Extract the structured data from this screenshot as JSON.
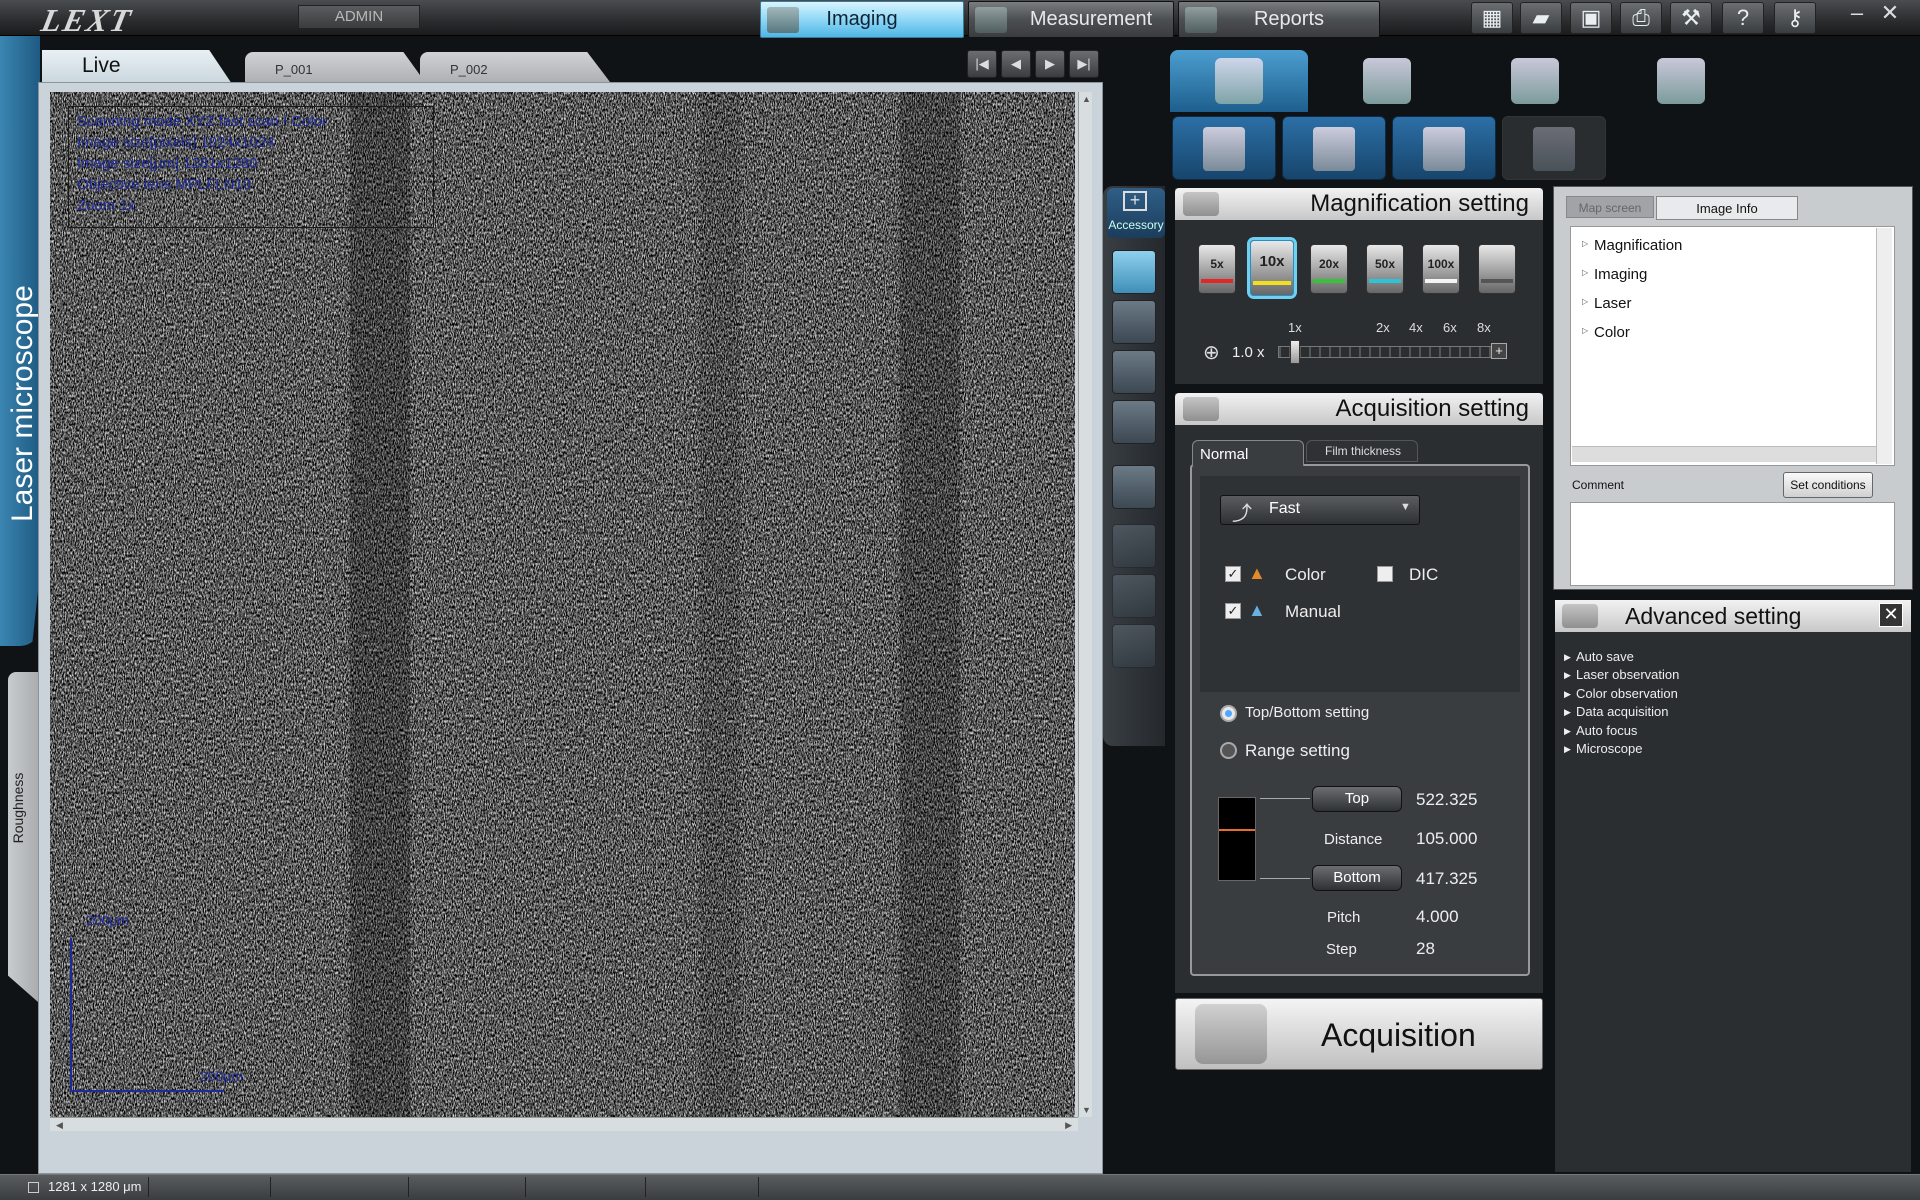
{
  "app": {
    "logo": "LEXT",
    "user": "ADMIN",
    "side_label": "Laser microscope",
    "roughness_tab": "Roughness"
  },
  "modes": [
    {
      "label": "Imaging",
      "active": true
    },
    {
      "label": "Measurement",
      "active": false
    },
    {
      "label": "Reports",
      "active": false
    }
  ],
  "toolbar_icons": [
    "calculator-icon",
    "open-folder-icon",
    "save-icon",
    "print-icon",
    "wrench-icon",
    "help-icon",
    "key-icon"
  ],
  "window_controls": {
    "minimize": "–",
    "close": "✕"
  },
  "image_tabs": [
    {
      "label": "Live",
      "active": true
    },
    {
      "label": "P_001",
      "active": false
    },
    {
      "label": "P_002",
      "active": false
    }
  ],
  "image_overlay": [
    "Scanning mode XYZ fast scan / Color",
    "Image size[pixels]  1024x1024",
    "Image size[μm]  1281x1280",
    "Objective lens MPLFLN10",
    "Zoom  1x"
  ],
  "scale_bar": {
    "vertical": "200μm",
    "horizontal": "200μm"
  },
  "tools": {
    "accessory_label": "Accessory"
  },
  "magnification": {
    "title": "Magnification setting",
    "objectives": [
      {
        "label": "5x",
        "band": "#e02828",
        "selected": false
      },
      {
        "label": "10x",
        "band": "#f2e01e",
        "selected": true
      },
      {
        "label": "20x",
        "band": "#3ac03a",
        "selected": false
      },
      {
        "label": "50x",
        "band": "#2cc4d8",
        "selected": false
      },
      {
        "label": "100x",
        "band": "#f4f4f4",
        "selected": false
      },
      {
        "label": "",
        "band": "#555555",
        "selected": false
      }
    ],
    "zoom_marks": [
      "1x",
      "2x",
      "4x",
      "6x",
      "8x"
    ],
    "zoom_value": "1.0",
    "zoom_unit": "x"
  },
  "acquisition": {
    "title": "Acquisition setting",
    "tabs": [
      "Normal",
      "Film thickness"
    ],
    "speed": "Fast",
    "color_label": "Color",
    "color_checked": true,
    "dic_label": "DIC",
    "dic_checked": false,
    "manual_label": "Manual",
    "manual_checked": true,
    "mode_topbottom": "Top/Bottom setting",
    "mode_range": "Range setting",
    "top_btn": "Top",
    "top_val": "522.325",
    "distance_lbl": "Distance",
    "distance_val": "105.000",
    "bottom_btn": "Bottom",
    "bottom_val": "417.325",
    "pitch_lbl": "Pitch",
    "pitch_val": "4.000",
    "step_lbl": "Step",
    "step_val": "28",
    "button": "Acquisition"
  },
  "info_panel": {
    "tabs": [
      "Map screen",
      "Image Info"
    ],
    "tree": [
      "Magnification",
      "Imaging",
      "Laser",
      "Color"
    ],
    "comment_label": "Comment",
    "set_conditions": "Set conditions"
  },
  "advanced": {
    "title": "Advanced setting",
    "items": [
      "Auto save",
      "Laser observation",
      "Color observation",
      "Data acquisition",
      "Auto focus",
      "Microscope"
    ]
  },
  "status": {
    "size": "1281 x 1280 μm"
  }
}
